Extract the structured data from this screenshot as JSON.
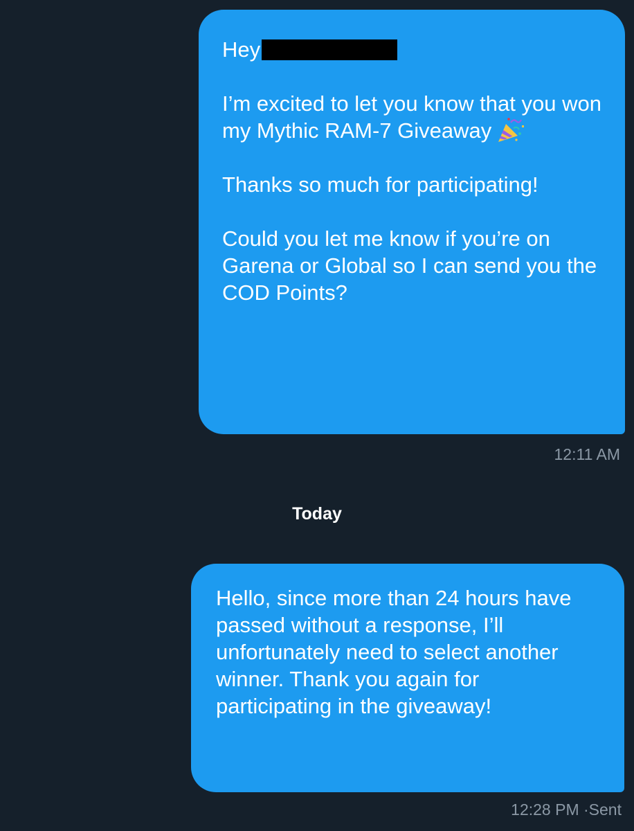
{
  "conversation": {
    "messages": [
      {
        "greeting": "Hey",
        "paragraphs": [
          "I’m excited to let you know that you won my Mythic RAM-7 Giveaway",
          "Thanks so much for participating!",
          "Could you let me know if you’re on Garena or Global so I can send you the COD Points?"
        ],
        "emoji": "party-popper-icon",
        "timestamp": "12:11 AM"
      },
      {
        "text": "Hello, since more than 24 hours have passed without a response, I’ll unfortunately need to select another winner. Thank you again for participating in the giveaway!",
        "timestamp": "12:28 PM",
        "separator": "·",
        "status": "Sent"
      }
    ],
    "day_divider": "Today"
  },
  "colors": {
    "background": "#15202b",
    "bubble": "#1d9bf0",
    "timestamp": "#8b98a5",
    "text": "#ffffff"
  }
}
